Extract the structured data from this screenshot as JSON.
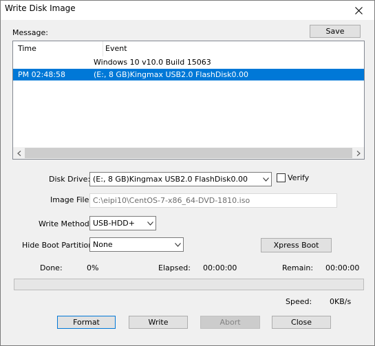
{
  "window": {
    "title": "Write Disk Image"
  },
  "message": {
    "label": "Message:",
    "save_label": "Save",
    "columns": {
      "time": "Time",
      "event": "Event"
    },
    "rows": [
      {
        "time": "",
        "event": "Windows 10 v10.0 Build 15063",
        "selected": false
      },
      {
        "time": "PM 02:48:58",
        "event": "(E:, 8 GB)Kingmax USB2.0 FlashDisk0.00",
        "selected": true
      }
    ]
  },
  "form": {
    "disk_drive_label": "Disk Drive:",
    "disk_drive_value": "(E:, 8 GB)Kingmax USB2.0 FlashDisk0.00",
    "verify_label": "Verify",
    "verify_checked": false,
    "image_file_label": "Image File:",
    "image_file_value": "C:\\eipi10\\CentOS-7-x86_64-DVD-1810.iso",
    "write_method_label": "Write Method:",
    "write_method_value": "USB-HDD+",
    "hide_boot_label": "Hide Boot Partition:",
    "hide_boot_value": "None",
    "xpress_boot_label": "Xpress Boot"
  },
  "status": {
    "done_label": "Done:",
    "done_value": "0%",
    "elapsed_label": "Elapsed:",
    "elapsed_value": "00:00:00",
    "remain_label": "Remain:",
    "remain_value": "00:00:00",
    "speed_label": "Speed:",
    "speed_value": "0KB/s",
    "progress_fraction": 0
  },
  "buttons": {
    "format": "Format",
    "write": "Write",
    "abort": "Abort",
    "close": "Close"
  },
  "colors": {
    "selection": "#0078d7",
    "focus_border": "#0078d7",
    "progress_fill": "#06b025"
  },
  "icons": {
    "close": "close-icon",
    "scroll_left": "chevron-left-icon",
    "scroll_right": "chevron-right-icon",
    "dropdown": "chevron-down-icon"
  }
}
